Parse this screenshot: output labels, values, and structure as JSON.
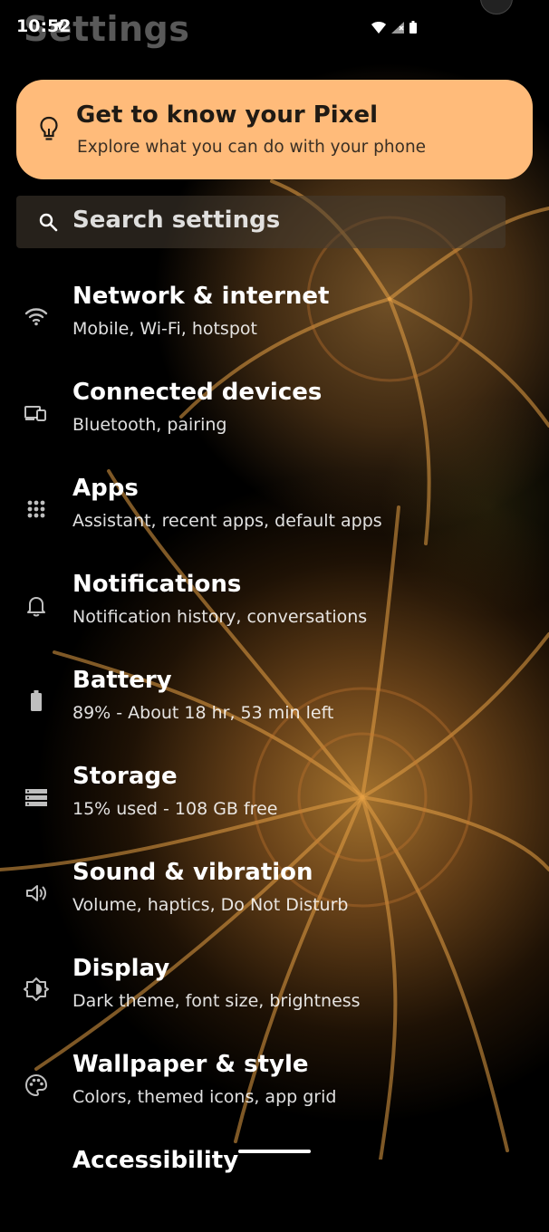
{
  "status_bar": {
    "time": "10:52"
  },
  "page_title": "Settings",
  "tips_card": {
    "title": "Get to know your Pixel",
    "subtitle": "Explore what you can do with your phone"
  },
  "search": {
    "placeholder": "Search settings"
  },
  "settings": [
    {
      "title": "Network & internet",
      "subtitle": "Mobile, Wi-Fi, hotspot",
      "icon": "wifi-icon"
    },
    {
      "title": "Connected devices",
      "subtitle": "Bluetooth, pairing",
      "icon": "devices-icon"
    },
    {
      "title": "Apps",
      "subtitle": "Assistant, recent apps, default apps",
      "icon": "apps-grid-icon"
    },
    {
      "title": "Notifications",
      "subtitle": "Notification history, conversations",
      "icon": "bell-icon"
    },
    {
      "title": "Battery",
      "subtitle": "89% - About 18 hr, 53 min left",
      "icon": "battery-icon"
    },
    {
      "title": "Storage",
      "subtitle": "15% used - 108 GB free",
      "icon": "storage-icon"
    },
    {
      "title": "Sound & vibration",
      "subtitle": "Volume, haptics, Do Not Disturb",
      "icon": "speaker-icon"
    },
    {
      "title": "Display",
      "subtitle": "Dark theme, font size, brightness",
      "icon": "brightness-icon"
    },
    {
      "title": "Wallpaper & style",
      "subtitle": "Colors, themed icons, app grid",
      "icon": "palette-icon"
    },
    {
      "title": "Accessibility",
      "subtitle": "",
      "icon": "accessibility-icon"
    }
  ],
  "colors": {
    "tips_card_bg": "#ffbb7a",
    "background": "#000000",
    "text_primary": "#ffffff"
  }
}
